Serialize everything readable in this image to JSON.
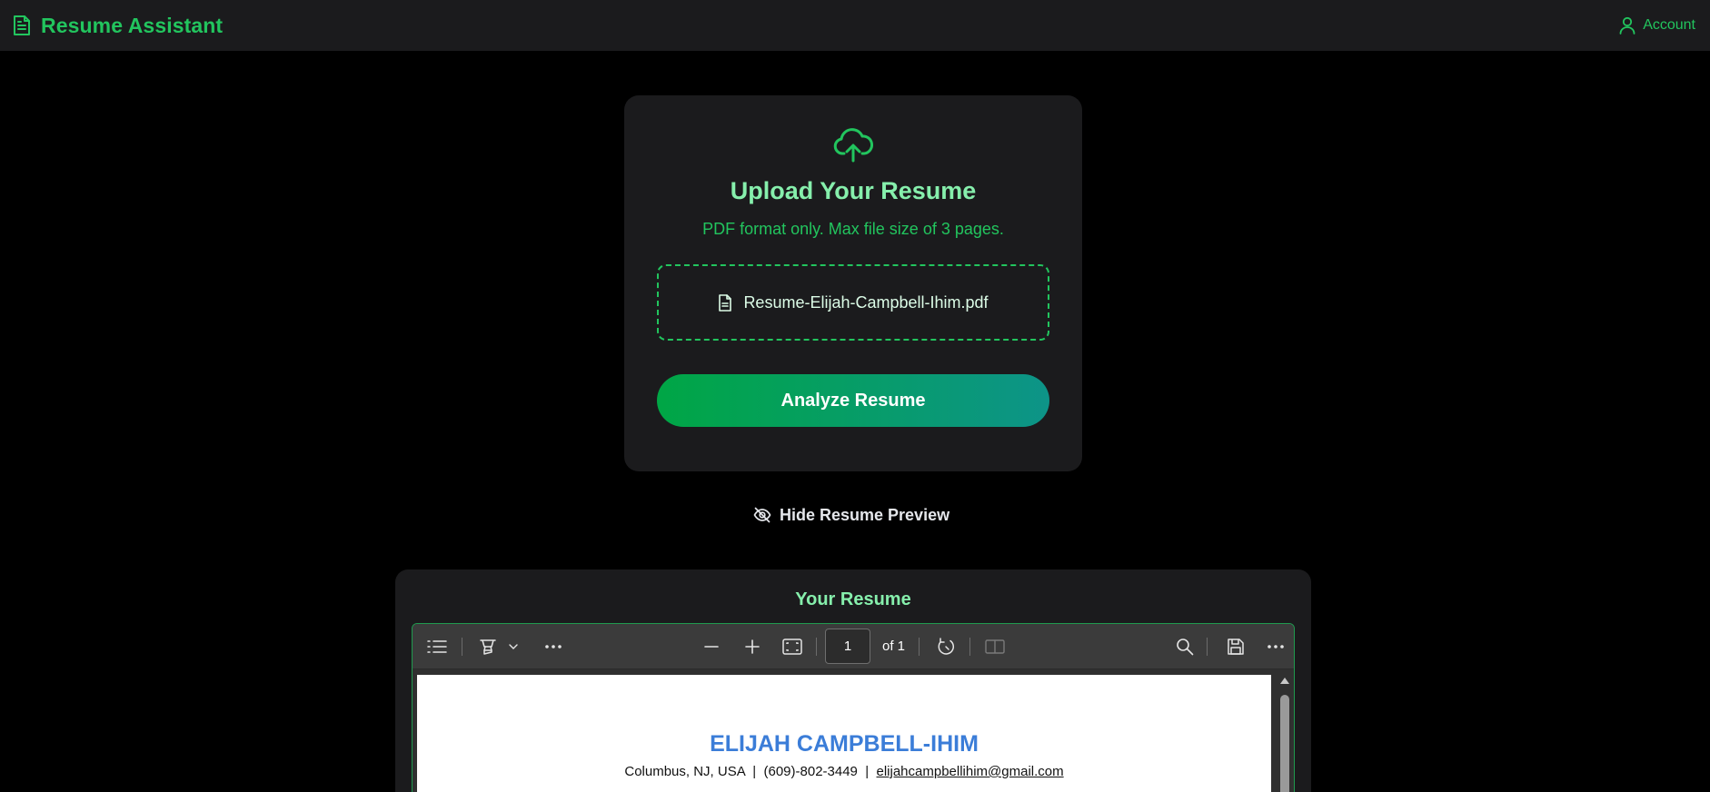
{
  "app": {
    "name": "Resume Assistant",
    "account_label": "Account",
    "accent_color": "#22c55e"
  },
  "upload": {
    "icon": "cloud-upload-icon",
    "title": "Upload Your Resume",
    "subtitle": "PDF format only. Max file size of 3 pages.",
    "selected_file": "Resume-Elijah-Campbell-Ihim.pdf",
    "file_icon": "file-icon",
    "analyze_label": "Analyze Resume"
  },
  "preview_toggle": {
    "icon": "eye-off-icon",
    "label": "Hide Resume Preview"
  },
  "preview": {
    "title": "Your Resume",
    "toolbar": {
      "icons": [
        "table-of-contents-icon",
        "highlighter-icon",
        "chevron-down-icon",
        "more-options-icon",
        "zoom-out-icon",
        "zoom-in-icon",
        "fit-page-icon",
        "rotate-icon",
        "two-page-view-icon",
        "search-icon",
        "save-icon",
        "more-options-icon"
      ],
      "current_page": "1",
      "page_total_label": "of 1"
    },
    "document": {
      "name": "ELIJAH CAMPBELL-IHIM",
      "location": "Columbus, NJ, USA",
      "phone": "(609)-802-3449",
      "email": "elijahcampbellihim@gmail.com",
      "separator": "|"
    }
  }
}
